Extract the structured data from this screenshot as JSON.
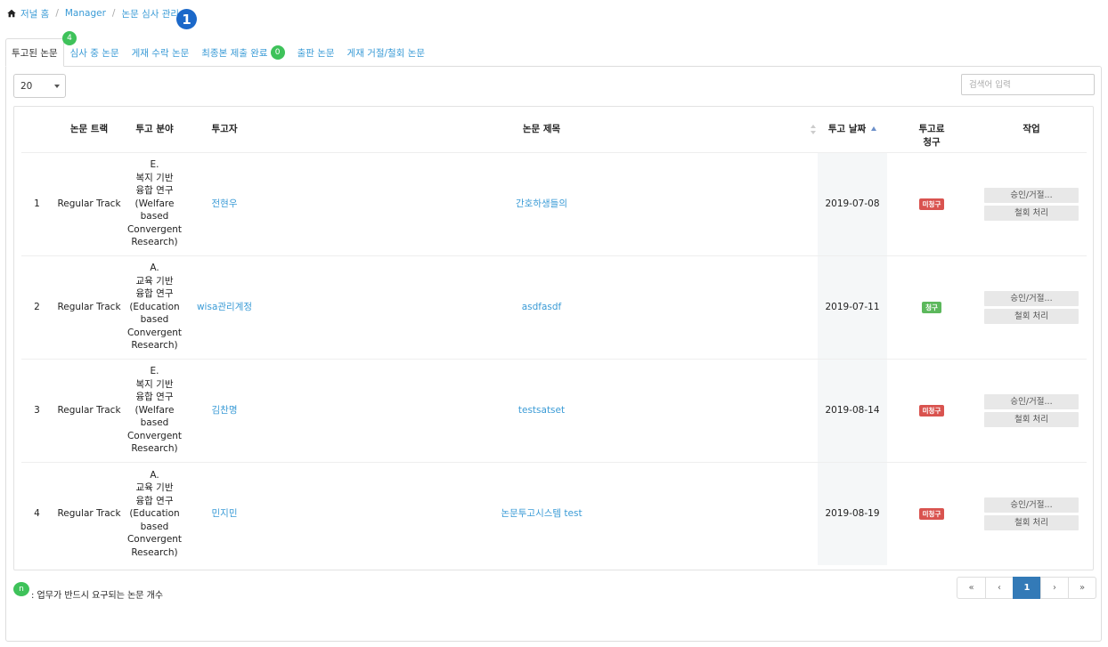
{
  "breadcrumb": {
    "home_icon": "home-icon",
    "items": [
      "저널 홈",
      "Manager",
      "논문 심사 관리"
    ],
    "step_marker": "1"
  },
  "tabs": [
    {
      "label": "투고된 논문",
      "count": "4",
      "active": true
    },
    {
      "label": "심사 중 논문"
    },
    {
      "label": "게재 수락 논문"
    },
    {
      "label": "최종본 제출 완료",
      "count": "0"
    },
    {
      "label": "출판 논문"
    },
    {
      "label": "게재 거절/철회 논문"
    }
  ],
  "toolbar": {
    "page_size": "20",
    "search_placeholder": "검색어 입력"
  },
  "table": {
    "headers": {
      "no": "",
      "track": "논문 트랙",
      "field": "투고 분야",
      "author": "투고자",
      "title": "논문 제목",
      "date": "투고 날짜",
      "fee": "투고료\n청구",
      "action": "작업"
    },
    "rows": [
      {
        "no": "1",
        "track": "Regular Track",
        "field": "E.\n복지 기반\n융합 연구\n(Welfare\nbased\nConvergent\nResearch)",
        "author": "전현우",
        "title": "간호하생들의",
        "date": "2019-07-08",
        "fee": "미청구",
        "fee_status": "unpaid",
        "approve_label": "승인/거절...",
        "withdraw_label": "철회 처리"
      },
      {
        "no": "2",
        "track": "Regular Track",
        "field": "A.\n교육 기반\n융합 연구\n(Education\nbased\nConvergent\nResearch)",
        "author": "wisa관리계정",
        "title": "asdfasdf",
        "date": "2019-07-11",
        "fee": "청구",
        "fee_status": "paid",
        "approve_label": "승인/거절...",
        "withdraw_label": "철회 처리"
      },
      {
        "no": "3",
        "track": "Regular Track",
        "field": "E.\n복지 기반\n융합 연구\n(Welfare\nbased\nConvergent\nResearch)",
        "author": "김찬명",
        "title": "testsatset",
        "date": "2019-08-14",
        "fee": "미청구",
        "fee_status": "unpaid",
        "approve_label": "승인/거절...",
        "withdraw_label": "철회 처리"
      },
      {
        "no": "4",
        "track": "Regular Track",
        "field": "A.\n교육 기반\n융합 연구\n(Education\nbased\nConvergent\nResearch)",
        "author": "민지민",
        "title": "논문투고시스템 test",
        "date": "2019-08-19",
        "fee": "미청구",
        "fee_status": "unpaid",
        "approve_label": "승인/거절...",
        "withdraw_label": "철회 처리"
      }
    ]
  },
  "legend": {
    "dot_label": "n",
    "text": ": 업무가 반드시 요구되는 논문 개수"
  },
  "pagination": {
    "first": "«",
    "prev": "‹",
    "current": "1",
    "next": "›",
    "last": "»"
  },
  "colors": {
    "link": "#3a9bd6",
    "count_badge": "#3ec25a",
    "unpaid": "#d9534f",
    "paid": "#5cb85c",
    "active_page": "#337ab7",
    "step_marker": "#1b68c9"
  }
}
